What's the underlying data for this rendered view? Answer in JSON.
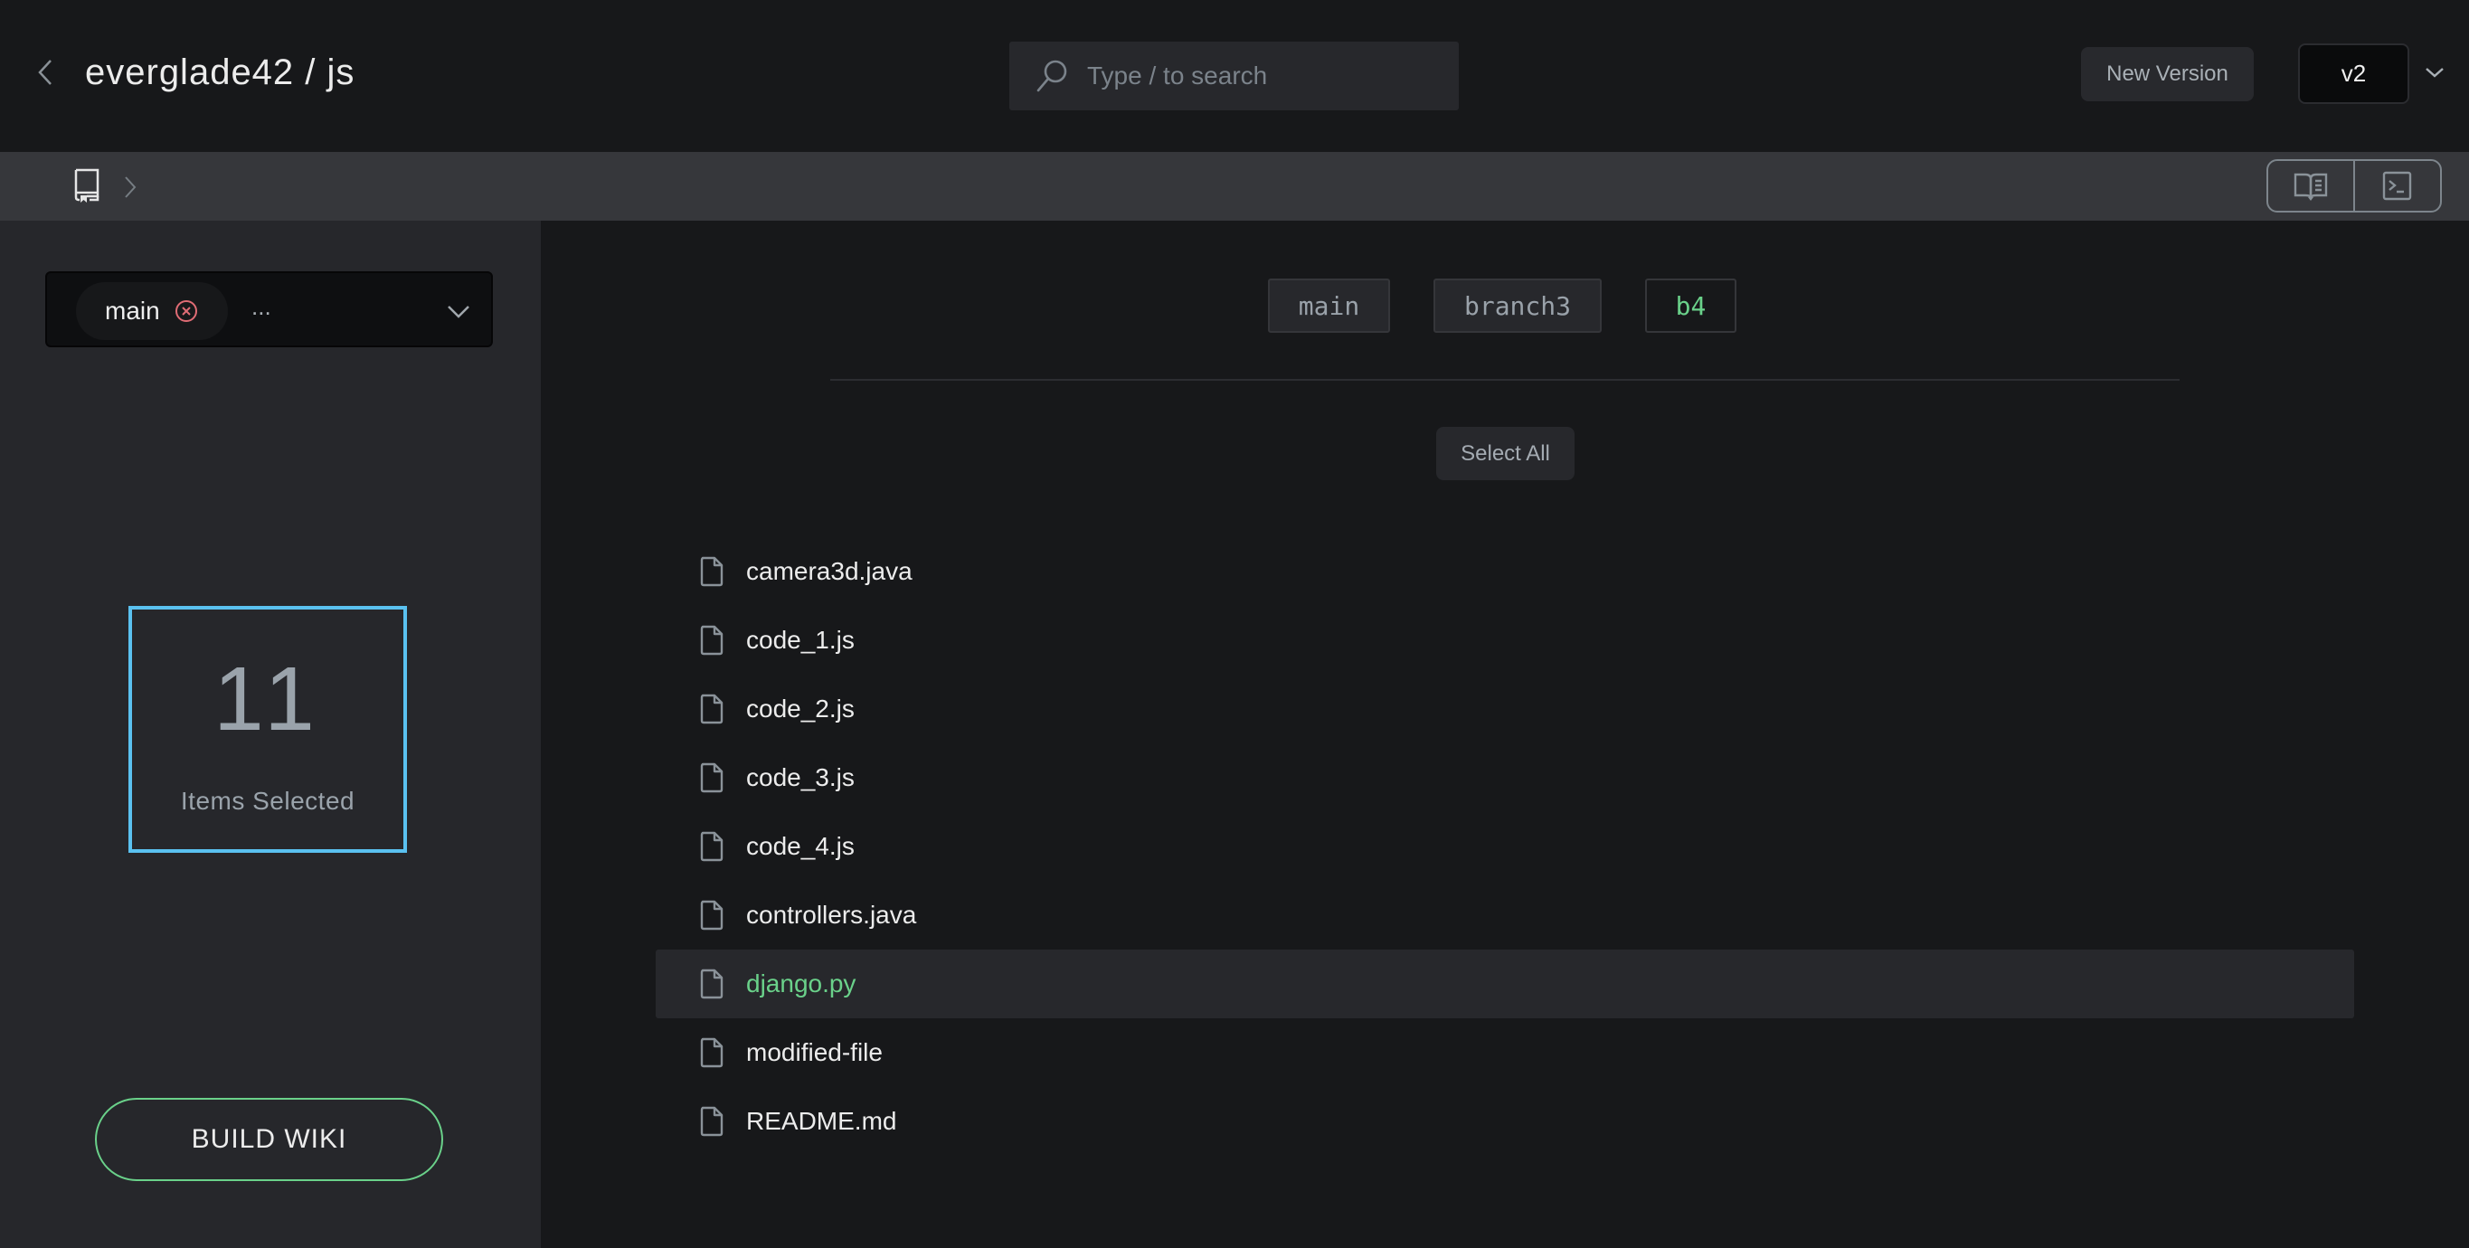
{
  "header": {
    "back_icon": "chevron-left-icon",
    "title": "everglade42 / js",
    "search": {
      "icon": "search-icon",
      "placeholder": "Type / to search",
      "value": ""
    },
    "new_version_label": "New Version",
    "version_select": {
      "selected": "v2",
      "chevron_icon": "chevron-down-icon"
    }
  },
  "subbar": {
    "breadcrumb": [
      {
        "icon": "repo-book-icon"
      },
      {
        "icon": "chevron-right-icon"
      }
    ],
    "view_toggle": [
      {
        "name": "wiki-view",
        "icon": "open-book-icon"
      },
      {
        "name": "terminal-view",
        "icon": "terminal-icon"
      }
    ]
  },
  "sidebar": {
    "branch_select": {
      "chips": [
        {
          "label": "main",
          "remove_icon": "close-circle-icon"
        }
      ],
      "overflow_text": "...",
      "chevron_icon": "chevron-down-icon"
    },
    "selection": {
      "count": "11",
      "label": "Items Selected"
    },
    "build_button_label": "BUILD WIKI"
  },
  "main": {
    "branch_tabs": [
      {
        "label": "main",
        "active": false
      },
      {
        "label": "branch3",
        "active": false
      },
      {
        "label": "b4",
        "active": true
      }
    ],
    "select_all_label": "Select All",
    "files": [
      {
        "name": "camera3d.java",
        "active": false
      },
      {
        "name": "code_1.js",
        "active": false
      },
      {
        "name": "code_2.js",
        "active": false
      },
      {
        "name": "code_3.js",
        "active": false
      },
      {
        "name": "code_4.js",
        "active": false
      },
      {
        "name": "controllers.java",
        "active": false
      },
      {
        "name": "django.py",
        "active": true
      },
      {
        "name": "modified-file",
        "active": false
      },
      {
        "name": "README.md",
        "active": false
      }
    ]
  },
  "colors": {
    "accent_green": "#6ad18a",
    "accent_blue": "#5ac1f0",
    "danger_red": "#e06c75",
    "background": "#17181a",
    "sidebar_bg": "#26272b"
  }
}
